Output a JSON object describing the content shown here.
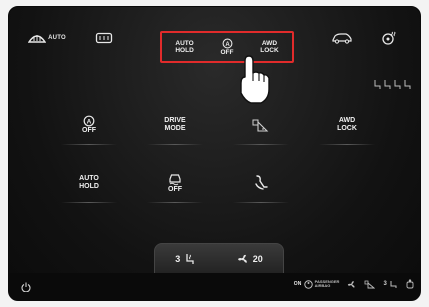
{
  "topbar": {
    "rear_defrost_auto_label": "AUTO",
    "quick": {
      "auto_hold_label": "AUTO\nHOLD",
      "off_label": "OFF",
      "awd_lock_label": "AWD\nLOCK"
    }
  },
  "tiles": {
    "tile1_label": "OFF",
    "drive_mode_label": "DRIVE\nMODE",
    "awd_lock_label": "AWD\nLOCK",
    "auto_hold_label": "AUTO\nHOLD",
    "traction_off_label": "OFF"
  },
  "hvac": {
    "seat_heat_level": "3",
    "fan_speed": "20"
  },
  "status": {
    "airbag_on": "ON",
    "passenger_airbag_text": "PASSENGER\nAIRBAG",
    "seat_heat_level": "3"
  }
}
